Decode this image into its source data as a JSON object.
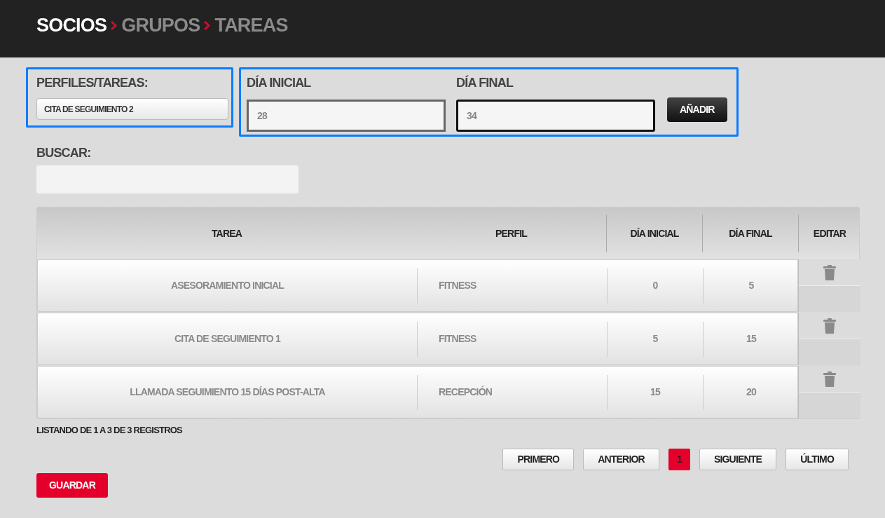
{
  "breadcrumb": [
    {
      "label": "SOCIOS",
      "selected": true
    },
    {
      "label": "GRUPOS",
      "selected": false
    },
    {
      "label": "TAREAS",
      "selected": false
    }
  ],
  "perfiles_tareas": {
    "label": "PERFILES/TAREAS:",
    "value": "CITA DE SEGUIMIENTO 2"
  },
  "dia_inicial": {
    "label": "DÍA INICIAL",
    "value": "28"
  },
  "dia_final": {
    "label": "DÍA FINAL",
    "value": "34"
  },
  "add_button": "AÑADIR",
  "search": {
    "label": "BUSCAR:"
  },
  "table": {
    "columns": [
      "TAREA",
      "PERFIL",
      "DÍA INICIAL",
      "DÍA FINAL",
      "EDITAR"
    ],
    "rows": [
      {
        "tarea": "ASESORAMIENTO INICIAL",
        "perfil": "FITNESS",
        "dia_inicial": "0",
        "dia_final": "5"
      },
      {
        "tarea": "CITA DE SEGUIMIENTO 1",
        "perfil": "FITNESS",
        "dia_inicial": "5",
        "dia_final": "15"
      },
      {
        "tarea": "LLAMADA SEGUIMIENTO 15 DÍAS POST-ALTA",
        "perfil": "RECEPCIÓN",
        "dia_inicial": "15",
        "dia_final": "20"
      }
    ]
  },
  "listing": "LISTANDO DE 1 A 3 DE 3 REGISTROS",
  "pagination": [
    {
      "label": "PRIMERO",
      "kind": "nav",
      "selected": false
    },
    {
      "label": "ANTERIOR",
      "kind": "nav",
      "selected": false
    },
    {
      "label": "1",
      "kind": "page",
      "selected": true
    },
    {
      "label": "SIGUIENTE",
      "kind": "nav",
      "selected": false
    },
    {
      "label": "ÚLTIMO",
      "kind": "nav",
      "selected": false
    }
  ],
  "save_button": "GUARDAR"
}
